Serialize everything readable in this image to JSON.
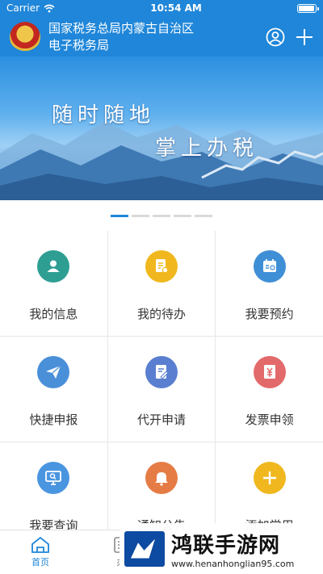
{
  "status": {
    "carrier": "Carrier",
    "time": "10:54 AM",
    "battery_level": 1.0
  },
  "header": {
    "title_line1": "国家税务总局内蒙古自治区",
    "title_line2": "电子税务局"
  },
  "banner": {
    "slogan_line1": "随时随地",
    "slogan_line2": "掌上办税",
    "page_count": 5,
    "active_page": 1
  },
  "grid": [
    {
      "label": "我的信息",
      "color": "#2e9e93",
      "icon": "user-icon"
    },
    {
      "label": "我的待办",
      "color": "#f0b81e",
      "icon": "todo-document-icon"
    },
    {
      "label": "我要预约",
      "color": "#3f8fd6",
      "icon": "calendar-icon"
    },
    {
      "label": "快捷申报",
      "color": "#4a90d9",
      "icon": "paper-plane-icon"
    },
    {
      "label": "代开申请",
      "color": "#5a7fd0",
      "icon": "edit-document-icon"
    },
    {
      "label": "发票申领",
      "color": "#e36a6a",
      "icon": "yuan-invoice-icon"
    },
    {
      "label": "我要查询",
      "color": "#4a95e0",
      "icon": "monitor-search-icon"
    },
    {
      "label": "通知公告",
      "color": "#e57c45",
      "icon": "bell-icon"
    },
    {
      "label": "添加常用",
      "color": "#f0b81e",
      "icon": "plus-icon"
    }
  ],
  "tabs": [
    {
      "label": "首页",
      "icon": "home-icon",
      "active": true
    },
    {
      "label": "办",
      "icon": "calculator-icon",
      "active": false
    }
  ],
  "watermark": {
    "title": "鸿联手游网",
    "url": "www.henanhonglian95.com"
  }
}
